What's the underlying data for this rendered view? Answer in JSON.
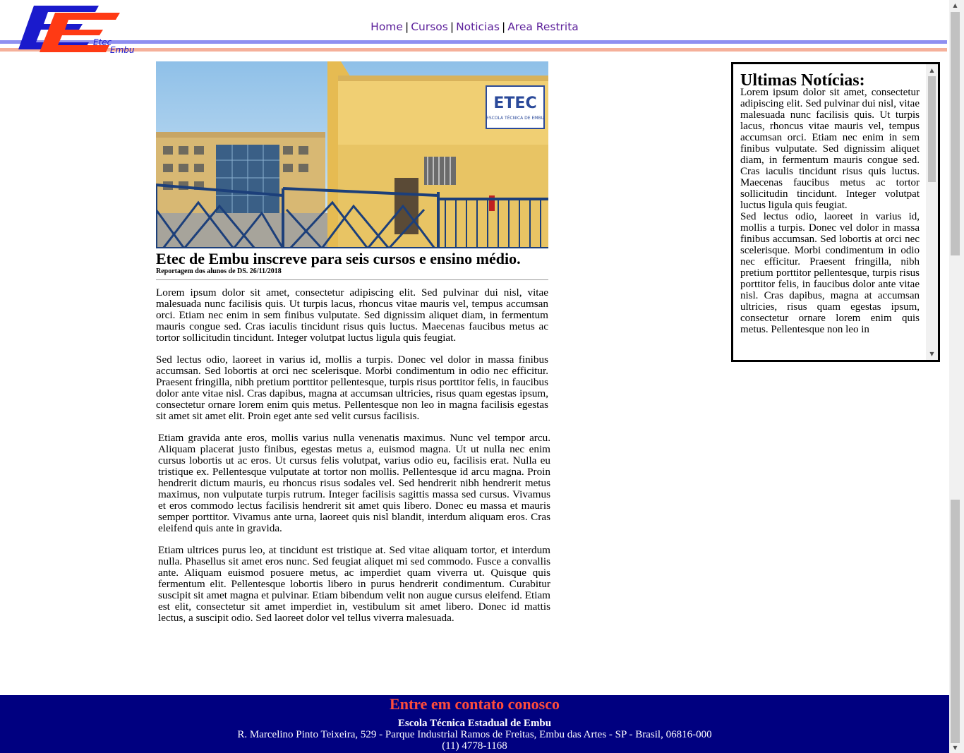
{
  "brand": {
    "logo_text_1": "Etec",
    "logo_text_2": "Embu"
  },
  "nav": {
    "items": [
      "Home",
      "Cursos",
      "Noticias",
      "Area Restrita"
    ],
    "separator": "|"
  },
  "article": {
    "image_sign_1": "ETEC",
    "image_sign_2": "ESCOLA TÉCNICA DE EMBU",
    "title": "Etec de Embu inscreve para seis cursos e ensino médio.",
    "byline": "Reportagem dos alunos de DS. 26/11/2018",
    "paragraphs": [
      "Lorem ipsum dolor sit amet, consectetur adipiscing elit. Sed pulvinar dui nisl, vitae malesuada nunc facilisis quis. Ut turpis lacus, rhoncus vitae mauris vel, tempus accumsan orci. Etiam nec enim in sem finibus vulputate. Sed dignissim aliquet diam, in fermentum mauris congue sed. Cras iaculis tincidunt risus quis luctus. Maecenas faucibus metus ac tortor sollicitudin tincidunt. Integer volutpat luctus ligula quis feugiat.",
      "Sed lectus odio, laoreet in varius id, mollis a turpis. Donec vel dolor in massa finibus accumsan. Sed lobortis at orci nec scelerisque. Morbi condimentum in odio nec efficitur. Praesent fringilla, nibh pretium porttitor pellentesque, turpis risus porttitor felis, in faucibus dolor ante vitae nisl. Cras dapibus, magna at accumsan ultricies, risus quam egestas ipsum, consectetur ornare lorem enim quis metus. Pellentesque non leo in magna facilisis egestas sit amet sit amet elit. Proin eget ante sed velit cursus facilisis.",
      "Etiam gravida ante eros, mollis varius nulla venenatis maximus. Nunc vel tempor arcu. Aliquam placerat justo finibus, egestas metus a, euismod magna. Ut ut nulla nec enim cursus lobortis ut ac eros. Ut cursus felis volutpat, varius odio eu, facilisis erat. Nulla eu tristique ex. Pellentesque vulputate at tortor non mollis. Pellentesque id arcu magna. Proin hendrerit dictum mauris, eu rhoncus risus sodales vel. Sed hendrerit nibh hendrerit metus maximus, non vulputate turpis rutrum. Integer facilisis sagittis massa sed cursus. Vivamus et eros commodo lectus facilisis hendrerit sit amet quis libero. Donec eu massa et mauris semper porttitor. Vivamus ante urna, laoreet quis nisl blandit, interdum aliquam eros. Cras eleifend quis ante in gravida.",
      "Etiam ultrices purus leo, at tincidunt est tristique at. Sed vitae aliquam tortor, et interdum nulla. Phasellus sit amet eros nunc. Sed feugiat aliquet mi sed commodo. Fusce a convallis ante. Aliquam euismod posuere metus, ac imperdiet quam viverra ut. Quisque quis fermentum elit. Pellentesque lobortis libero in purus hendrerit condimentum. Curabitur suscipit sit amet magna et pulvinar. Etiam bibendum velit non augue cursus eleifend. Etiam est elit, consectetur sit amet imperdiet in, vestibulum sit amet libero. Donec id mattis lectus, a suscipit odio. Sed laoreet dolor vel tellus viverra malesuada."
    ]
  },
  "sidebar": {
    "title": "Ultimas Notícias:",
    "paragraphs": [
      "Lorem ipsum dolor sit amet, consectetur adipiscing elit. Sed pulvinar dui nisl, vitae malesuada nunc facilisis quis. Ut turpis lacus, rhoncus vitae mauris vel, tempus accumsan orci. Etiam nec enim in sem finibus vulputate. Sed dignissim aliquet diam, in fermentum mauris congue sed. Cras iaculis tincidunt risus quis luctus. Maecenas faucibus metus ac tortor sollicitudin tincidunt. Integer volutpat luctus ligula quis feugiat.",
      "Sed lectus odio, laoreet in varius id, mollis a turpis. Donec vel dolor in massa finibus accumsan. Sed lobortis at orci nec scelerisque. Morbi condimentum in odio nec efficitur. Praesent fringilla, nibh pretium porttitor pellentesque, turpis risus porttitor felis, in faucibus dolor ante vitae nisl. Cras dapibus, magna at accumsan ultricies, risus quam egestas ipsum, consectetur ornare lorem enim quis metus. Pellentesque non leo in"
    ]
  },
  "footer": {
    "cta": "Entre em contato conosco",
    "school": "Escola Técnica Estadual de Embu",
    "address": "R. Marcelino Pinto Teixeira, 529 - Parque Industrial Ramos de Freitas, Embu das Artes - SP - Brasil, 06816-000",
    "phone": "(11) 4778-1168"
  },
  "colors": {
    "nav_link": "#5b1f9a",
    "stripe_blue": "#8f8ff0",
    "stripe_orange": "#f5b09a",
    "footer_bg": "#000080",
    "footer_cta": "#ff4c3b",
    "logo_blue": "#1a1acc",
    "logo_orange": "#ff3a14"
  }
}
